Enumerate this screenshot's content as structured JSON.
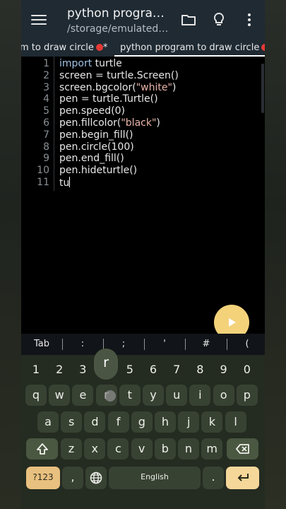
{
  "appbar": {
    "title": "python progra…",
    "subtitle": "/storage/emulated…",
    "icons": [
      "menu-icon",
      "folder-icon",
      "lightbulb-icon",
      "more-vert-icon"
    ]
  },
  "tabs": [
    {
      "label": "m to draw circle",
      "modified": true,
      "active": false
    },
    {
      "label": "python program to draw circle",
      "modified": true,
      "active": true
    }
  ],
  "code_lines": [
    {
      "n": "1",
      "parts": [
        {
          "t": "import",
          "c": "kw"
        },
        {
          "t": " turtle",
          "c": ""
        }
      ]
    },
    {
      "n": "2",
      "parts": [
        {
          "t": "screen = turtle.Screen()",
          "c": ""
        }
      ]
    },
    {
      "n": "3",
      "parts": [
        {
          "t": "screen.bgcolor(",
          "c": ""
        },
        {
          "t": "\"white\"",
          "c": "str"
        },
        {
          "t": ")",
          "c": ""
        }
      ]
    },
    {
      "n": "4",
      "parts": [
        {
          "t": "pen = turtle.Turtle()",
          "c": ""
        }
      ]
    },
    {
      "n": "5",
      "parts": [
        {
          "t": "pen.speed(0)",
          "c": ""
        }
      ]
    },
    {
      "n": "6",
      "parts": [
        {
          "t": "pen.fillcolor(",
          "c": ""
        },
        {
          "t": "\"black\"",
          "c": "str"
        },
        {
          "t": ")",
          "c": ""
        }
      ]
    },
    {
      "n": "7",
      "parts": [
        {
          "t": "pen.begin_fill()",
          "c": ""
        }
      ]
    },
    {
      "n": "8",
      "parts": [
        {
          "t": "pen.circle(100)",
          "c": ""
        }
      ]
    },
    {
      "n": "9",
      "parts": [
        {
          "t": "pen.end_fill()",
          "c": ""
        }
      ]
    },
    {
      "n": "10",
      "parts": [
        {
          "t": "pen.hideturtle()",
          "c": ""
        }
      ]
    },
    {
      "n": "11",
      "parts": [
        {
          "t": "tu",
          "c": ""
        }
      ],
      "caret": true
    }
  ],
  "run_button": {
    "icon": "play-icon"
  },
  "symbols": [
    "Tab",
    ":",
    ";",
    "'",
    "#",
    "("
  ],
  "keyboard": {
    "numbers": [
      "1",
      "2",
      "3",
      "4",
      "5",
      "6",
      "7",
      "8",
      "9",
      "0"
    ],
    "row1": [
      "q",
      "w",
      "e",
      "r",
      "t",
      "y",
      "u",
      "i",
      "o",
      "p"
    ],
    "row2": [
      "a",
      "s",
      "d",
      "f",
      "g",
      "h",
      "j",
      "k",
      "l"
    ],
    "row3": [
      "z",
      "x",
      "c",
      "v",
      "b",
      "n",
      "m"
    ],
    "key_popup": "r",
    "symbols_key": "?123",
    "comma_key": ",",
    "period_key": ".",
    "space_label": "English",
    "icons": [
      "shift-icon",
      "backspace-icon",
      "globe-icon",
      "enter-icon"
    ]
  }
}
